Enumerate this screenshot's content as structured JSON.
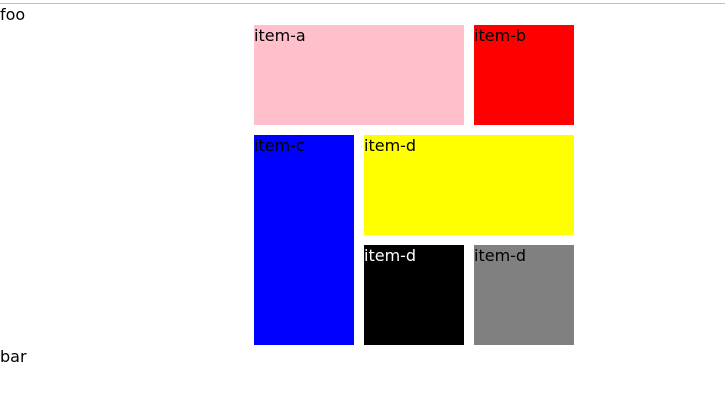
{
  "page": {
    "top_text": "foo",
    "bottom_text": "bar"
  },
  "grid": {
    "items": [
      {
        "label": "item-a",
        "color": "#ffc0cb",
        "text_color": "#000000"
      },
      {
        "label": "item-b",
        "color": "#ff0000",
        "text_color": "#000000"
      },
      {
        "label": "item-c",
        "color": "#0000ff",
        "text_color": "#000000"
      },
      {
        "label": "item-d",
        "color": "#ffff00",
        "text_color": "#000000"
      },
      {
        "label": "item-d",
        "color": "#000000",
        "text_color": "#ffffff"
      },
      {
        "label": "item-d",
        "color": "#808080",
        "text_color": "#000000"
      }
    ]
  }
}
